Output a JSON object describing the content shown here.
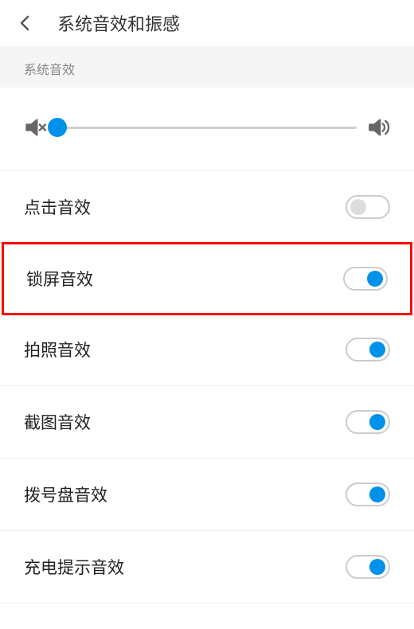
{
  "header": {
    "title": "系统音效和振感"
  },
  "section": {
    "label": "系统音效"
  },
  "slider": {
    "value": 0
  },
  "settings": [
    {
      "label": "点击音效",
      "on": false
    },
    {
      "label": "锁屏音效",
      "on": true,
      "highlighted": true
    },
    {
      "label": "拍照音效",
      "on": true
    },
    {
      "label": "截图音效",
      "on": true
    },
    {
      "label": "拨号盘音效",
      "on": true
    },
    {
      "label": "充电提示音效",
      "on": true
    }
  ]
}
